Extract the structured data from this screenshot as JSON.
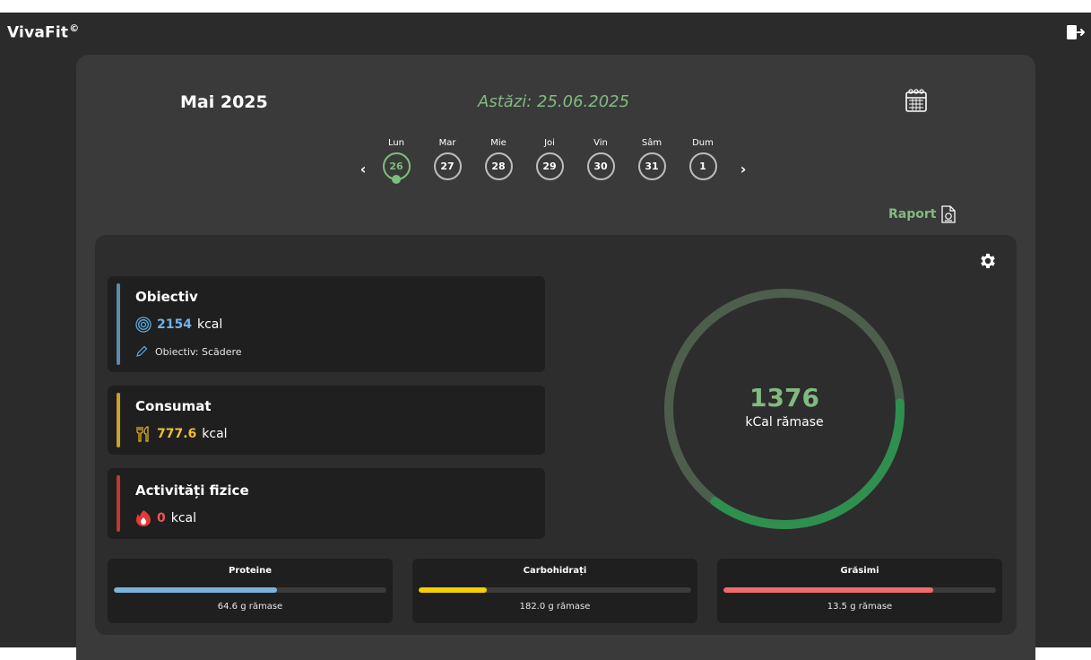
{
  "app": {
    "brand": "VivaFit",
    "brand_mark": "©"
  },
  "header": {
    "month": "Mai 2025",
    "today": "Astăzi: 25.06.2025",
    "report_label": "Raport"
  },
  "week": {
    "days": [
      {
        "name": "Lun",
        "num": "26",
        "active": true
      },
      {
        "name": "Mar",
        "num": "27"
      },
      {
        "name": "Mie",
        "num": "28"
      },
      {
        "name": "Joi",
        "num": "29"
      },
      {
        "name": "Vin",
        "num": "30"
      },
      {
        "name": "Sâm",
        "num": "31"
      },
      {
        "name": "Dum",
        "num": "1"
      }
    ]
  },
  "goal": {
    "title": "Obiectiv",
    "value": "2154",
    "unit": "kcal",
    "note": "Obiectiv: Scădere",
    "color": "#5b8aa8"
  },
  "consumed": {
    "title": "Consumat",
    "value": "777.6",
    "unit": "kcal",
    "color": "#c9a227"
  },
  "activity": {
    "title": "Activități fizice",
    "value": "0",
    "unit": "kcal",
    "color": "#c0392b"
  },
  "ring": {
    "remaining": "1376",
    "label": "kCal rămase",
    "consumed_fraction": 0.361
  },
  "macros": [
    {
      "name": "Proteine",
      "remaining": "64.6 g rămase",
      "fraction": 0.6,
      "color": "#7ab3db"
    },
    {
      "name": "Carbohidrați",
      "remaining": "182.0 g rămase",
      "fraction": 0.25,
      "color": "#f5d000"
    },
    {
      "name": "Grăsimi",
      "remaining": "13.5 g rămase",
      "fraction": 0.77,
      "color": "#f06b6b"
    }
  ],
  "colors": {
    "accent": "#80bb80",
    "ring_track": "#4d5e4d",
    "ring_fill": "#2f8f4f"
  }
}
